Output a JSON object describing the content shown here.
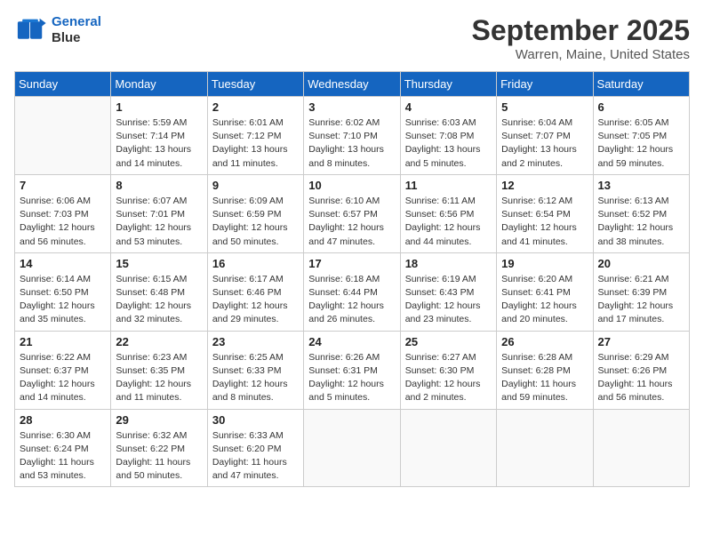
{
  "header": {
    "logo_line1": "General",
    "logo_line2": "Blue",
    "month": "September 2025",
    "location": "Warren, Maine, United States"
  },
  "weekdays": [
    "Sunday",
    "Monday",
    "Tuesday",
    "Wednesday",
    "Thursday",
    "Friday",
    "Saturday"
  ],
  "weeks": [
    [
      {
        "day": "",
        "info": ""
      },
      {
        "day": "1",
        "info": "Sunrise: 5:59 AM\nSunset: 7:14 PM\nDaylight: 13 hours\nand 14 minutes."
      },
      {
        "day": "2",
        "info": "Sunrise: 6:01 AM\nSunset: 7:12 PM\nDaylight: 13 hours\nand 11 minutes."
      },
      {
        "day": "3",
        "info": "Sunrise: 6:02 AM\nSunset: 7:10 PM\nDaylight: 13 hours\nand 8 minutes."
      },
      {
        "day": "4",
        "info": "Sunrise: 6:03 AM\nSunset: 7:08 PM\nDaylight: 13 hours\nand 5 minutes."
      },
      {
        "day": "5",
        "info": "Sunrise: 6:04 AM\nSunset: 7:07 PM\nDaylight: 13 hours\nand 2 minutes."
      },
      {
        "day": "6",
        "info": "Sunrise: 6:05 AM\nSunset: 7:05 PM\nDaylight: 12 hours\nand 59 minutes."
      }
    ],
    [
      {
        "day": "7",
        "info": "Sunrise: 6:06 AM\nSunset: 7:03 PM\nDaylight: 12 hours\nand 56 minutes."
      },
      {
        "day": "8",
        "info": "Sunrise: 6:07 AM\nSunset: 7:01 PM\nDaylight: 12 hours\nand 53 minutes."
      },
      {
        "day": "9",
        "info": "Sunrise: 6:09 AM\nSunset: 6:59 PM\nDaylight: 12 hours\nand 50 minutes."
      },
      {
        "day": "10",
        "info": "Sunrise: 6:10 AM\nSunset: 6:57 PM\nDaylight: 12 hours\nand 47 minutes."
      },
      {
        "day": "11",
        "info": "Sunrise: 6:11 AM\nSunset: 6:56 PM\nDaylight: 12 hours\nand 44 minutes."
      },
      {
        "day": "12",
        "info": "Sunrise: 6:12 AM\nSunset: 6:54 PM\nDaylight: 12 hours\nand 41 minutes."
      },
      {
        "day": "13",
        "info": "Sunrise: 6:13 AM\nSunset: 6:52 PM\nDaylight: 12 hours\nand 38 minutes."
      }
    ],
    [
      {
        "day": "14",
        "info": "Sunrise: 6:14 AM\nSunset: 6:50 PM\nDaylight: 12 hours\nand 35 minutes."
      },
      {
        "day": "15",
        "info": "Sunrise: 6:15 AM\nSunset: 6:48 PM\nDaylight: 12 hours\nand 32 minutes."
      },
      {
        "day": "16",
        "info": "Sunrise: 6:17 AM\nSunset: 6:46 PM\nDaylight: 12 hours\nand 29 minutes."
      },
      {
        "day": "17",
        "info": "Sunrise: 6:18 AM\nSunset: 6:44 PM\nDaylight: 12 hours\nand 26 minutes."
      },
      {
        "day": "18",
        "info": "Sunrise: 6:19 AM\nSunset: 6:43 PM\nDaylight: 12 hours\nand 23 minutes."
      },
      {
        "day": "19",
        "info": "Sunrise: 6:20 AM\nSunset: 6:41 PM\nDaylight: 12 hours\nand 20 minutes."
      },
      {
        "day": "20",
        "info": "Sunrise: 6:21 AM\nSunset: 6:39 PM\nDaylight: 12 hours\nand 17 minutes."
      }
    ],
    [
      {
        "day": "21",
        "info": "Sunrise: 6:22 AM\nSunset: 6:37 PM\nDaylight: 12 hours\nand 14 minutes."
      },
      {
        "day": "22",
        "info": "Sunrise: 6:23 AM\nSunset: 6:35 PM\nDaylight: 12 hours\nand 11 minutes."
      },
      {
        "day": "23",
        "info": "Sunrise: 6:25 AM\nSunset: 6:33 PM\nDaylight: 12 hours\nand 8 minutes."
      },
      {
        "day": "24",
        "info": "Sunrise: 6:26 AM\nSunset: 6:31 PM\nDaylight: 12 hours\nand 5 minutes."
      },
      {
        "day": "25",
        "info": "Sunrise: 6:27 AM\nSunset: 6:30 PM\nDaylight: 12 hours\nand 2 minutes."
      },
      {
        "day": "26",
        "info": "Sunrise: 6:28 AM\nSunset: 6:28 PM\nDaylight: 11 hours\nand 59 minutes."
      },
      {
        "day": "27",
        "info": "Sunrise: 6:29 AM\nSunset: 6:26 PM\nDaylight: 11 hours\nand 56 minutes."
      }
    ],
    [
      {
        "day": "28",
        "info": "Sunrise: 6:30 AM\nSunset: 6:24 PM\nDaylight: 11 hours\nand 53 minutes."
      },
      {
        "day": "29",
        "info": "Sunrise: 6:32 AM\nSunset: 6:22 PM\nDaylight: 11 hours\nand 50 minutes."
      },
      {
        "day": "30",
        "info": "Sunrise: 6:33 AM\nSunset: 6:20 PM\nDaylight: 11 hours\nand 47 minutes."
      },
      {
        "day": "",
        "info": ""
      },
      {
        "day": "",
        "info": ""
      },
      {
        "day": "",
        "info": ""
      },
      {
        "day": "",
        "info": ""
      }
    ]
  ]
}
